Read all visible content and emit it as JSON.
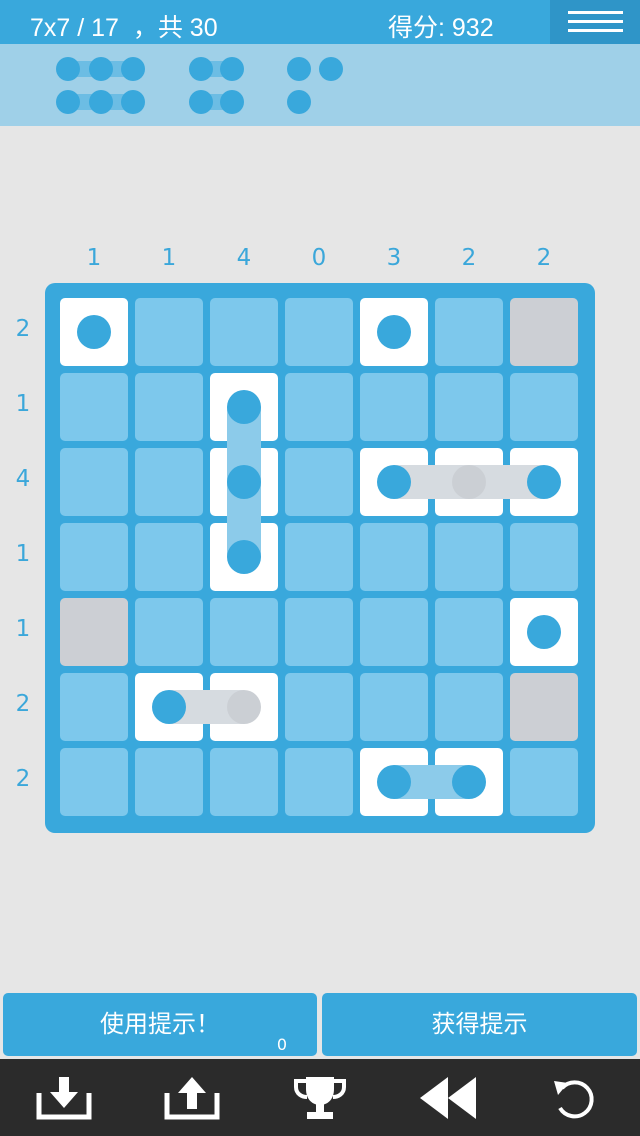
{
  "header": {
    "level": "7x7 / 17  ，共 30",
    "score": "得分: 932"
  },
  "column_hints": [
    "1",
    "1",
    "4",
    "0",
    "3",
    "2",
    "2"
  ],
  "row_hints": [
    "2",
    "1",
    "4",
    "1",
    "1",
    "2",
    "2"
  ],
  "board": {
    "size": 7,
    "ship_cells": [
      [
        0,
        0
      ],
      [
        0,
        4
      ],
      [
        1,
        2
      ],
      [
        2,
        2
      ],
      [
        2,
        4
      ],
      [
        2,
        5
      ],
      [
        2,
        6
      ],
      [
        3,
        2
      ],
      [
        4,
        6
      ],
      [
        5,
        1
      ],
      [
        5,
        2
      ],
      [
        6,
        4
      ],
      [
        6,
        5
      ]
    ],
    "rock_cells": [
      [
        0,
        6
      ],
      [
        4,
        0
      ],
      [
        5,
        6
      ]
    ],
    "blue_dots": [
      [
        0,
        0
      ],
      [
        0,
        4
      ],
      [
        1,
        2
      ],
      [
        2,
        2
      ],
      [
        2,
        4
      ],
      [
        2,
        6
      ],
      [
        3,
        2
      ],
      [
        4,
        6
      ],
      [
        5,
        1
      ],
      [
        6,
        4
      ],
      [
        6,
        5
      ]
    ],
    "gray_dots": [
      [
        2,
        5
      ],
      [
        5,
        2
      ]
    ]
  },
  "pieces": [
    {
      "group": "length-3",
      "count": 2
    },
    {
      "group": "length-2",
      "count": 2
    },
    {
      "group": "length-1",
      "count": 3
    }
  ],
  "buttons": {
    "use_hint": "使用提示！",
    "hint_count": "0",
    "get_hint": "获得提示"
  },
  "toolbar": {
    "icons": [
      "download-icon",
      "upload-icon",
      "trophy-icon",
      "rewind-icon",
      "undo-icon"
    ]
  },
  "colors": {
    "primary": "#39a8dc",
    "cell": "#7dc8ec",
    "ship": "#ffffff",
    "rock": "#cccfd4",
    "toolbar": "#2b2b2b"
  }
}
